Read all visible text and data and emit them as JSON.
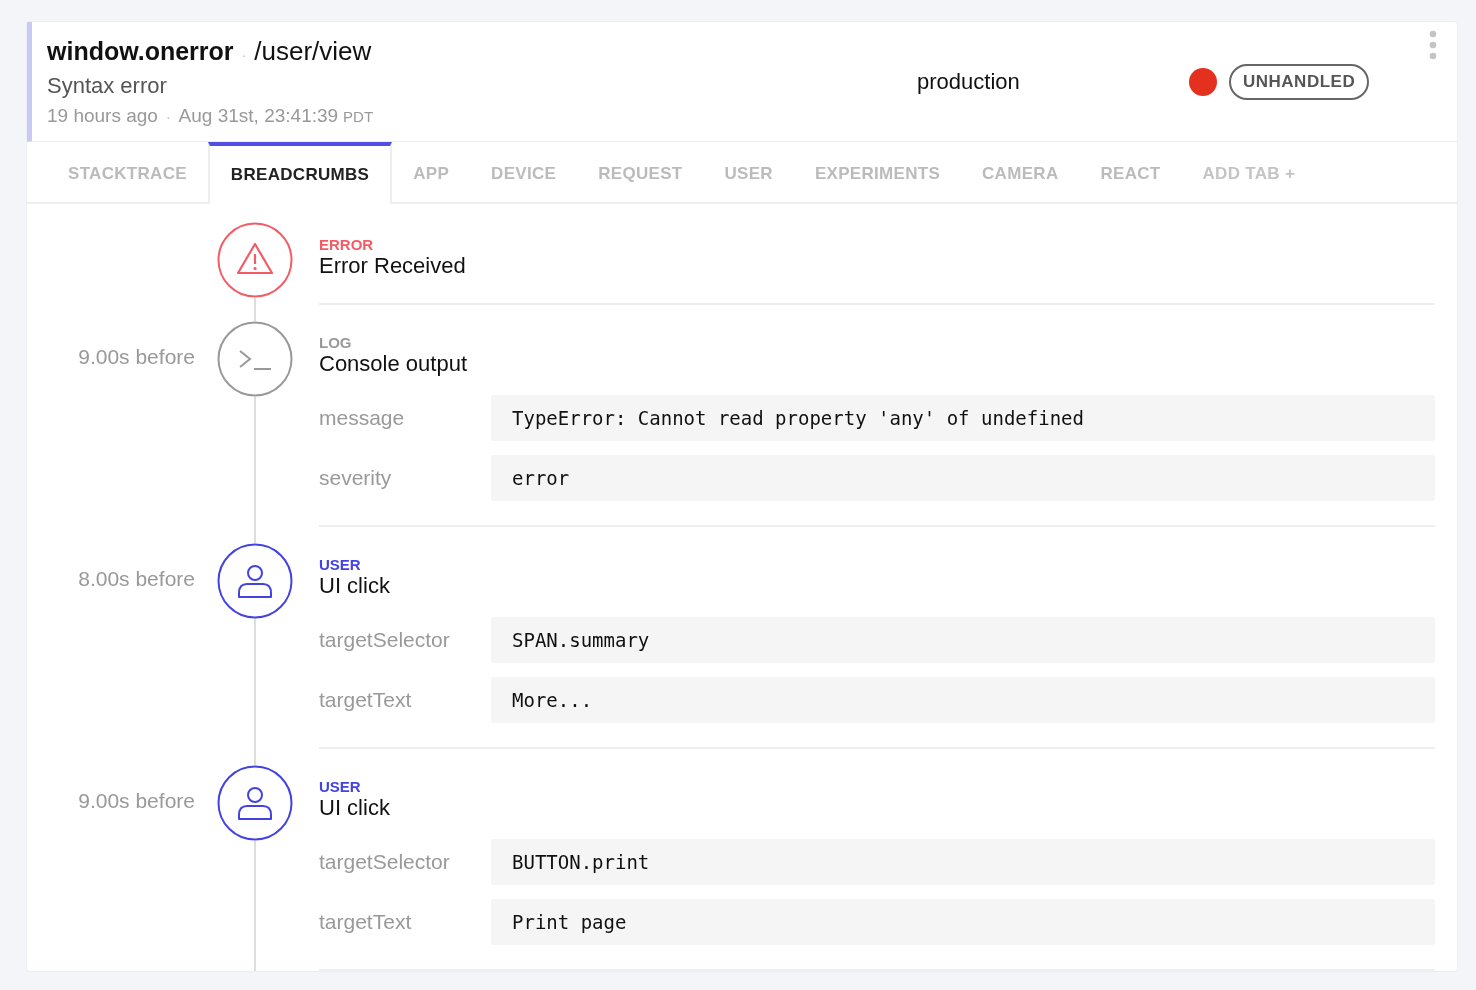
{
  "header": {
    "error_class": "window.onerror",
    "title_separator": "·",
    "context": "/user/view",
    "message": "Syntax error",
    "relative_time": "19 hours ago",
    "time_separator": "·",
    "timestamp": "Aug 31st, 23:41:39",
    "timezone": "PDT",
    "release_stage": "production",
    "indicators": [
      {
        "kind": "dot",
        "color": "#e3301f"
      },
      {
        "kind": "badge",
        "label": "UNHANDLED"
      }
    ]
  },
  "tabs": [
    {
      "label": "STACKTRACE",
      "selected": false,
      "kind": "tab"
    },
    {
      "label": "BREADCRUMBS",
      "selected": true,
      "kind": "tab"
    },
    {
      "label": "APP",
      "selected": false,
      "kind": "tab"
    },
    {
      "label": "DEVICE",
      "selected": false,
      "kind": "tab"
    },
    {
      "label": "REQUEST",
      "selected": false,
      "kind": "tab"
    },
    {
      "label": "USER",
      "selected": false,
      "kind": "tab"
    },
    {
      "label": "EXPERIMENTS",
      "selected": false,
      "kind": "tab"
    },
    {
      "label": "CAMERA",
      "selected": false,
      "kind": "tab"
    },
    {
      "label": "REACT",
      "selected": false,
      "kind": "tab"
    },
    {
      "label": "ADD TAB +",
      "selected": false,
      "kind": "add"
    }
  ],
  "breadcrumbs": [
    {
      "kind": "error",
      "category": "ERROR",
      "title": "Error Received"
    },
    {
      "kind": "log",
      "time": "9.00s before",
      "category": "LOG",
      "title": "Console output",
      "fields": [
        {
          "key": "message",
          "value": "TypeError: Cannot read property 'any' of undefined"
        },
        {
          "key": "severity",
          "value": "error"
        }
      ]
    },
    {
      "kind": "user",
      "time": "8.00s before",
      "category": "USER",
      "title": "UI click",
      "fields": [
        {
          "key": "targetSelector",
          "value": "SPAN.summary"
        },
        {
          "key": "targetText",
          "value": "More..."
        }
      ]
    },
    {
      "kind": "user",
      "time": "9.00s before",
      "category": "USER",
      "title": "UI click",
      "fields": [
        {
          "key": "targetSelector",
          "value": "BUTTON.print"
        },
        {
          "key": "targetText",
          "value": "Print page"
        }
      ]
    }
  ]
}
